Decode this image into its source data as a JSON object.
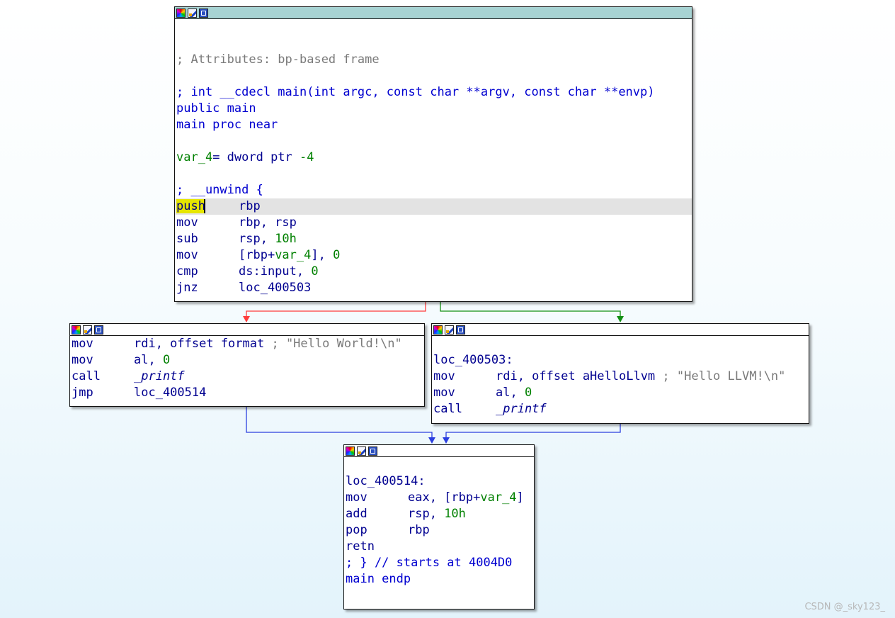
{
  "colors": {
    "edge_false": "#ff3b3b",
    "edge_true": "#138f13",
    "edge_unconditional": "#2b3fe0",
    "keyword_blue": "#0000d0",
    "number_green": "#008000",
    "comment_gray": "#7a7a7a",
    "active_titlebar": "#a7d3d3",
    "cursor_highlight": "#e6e600"
  },
  "titlebar_icons": [
    "color-palette-icon",
    "edit-node-icon",
    "graph-overview-icon"
  ],
  "node_main": {
    "lines": [
      {
        "text": ""
      },
      {
        "text": ""
      },
      {
        "comment": "; Attributes: bp-based frame"
      },
      {
        "text": ""
      },
      {
        "blue": "; int __cdecl main(int argc, const char **argv, const char **envp)"
      },
      {
        "blue": "public main"
      },
      {
        "blue": "main proc near"
      },
      {
        "text": ""
      },
      {
        "var_name": "var_4",
        "var_rest": "= dword ptr ",
        "var_num": "-4"
      },
      {
        "text": ""
      },
      {
        "blue": "; __unwind {"
      },
      {
        "mnemonic": "push",
        "operand": "rbp",
        "selected": true
      },
      {
        "mnemonic": "mov",
        "operand": "rbp, rsp"
      },
      {
        "mnemonic": "sub",
        "operand_pre": "rsp, ",
        "operand_num": "10h"
      },
      {
        "mnemonic": "mov",
        "operand_pre": "[rbp+",
        "operand_var": "var_4",
        "operand_post": "], ",
        "operand_num2": "0"
      },
      {
        "mnemonic": "cmp",
        "operand_pre": "ds:input, ",
        "operand_num": "0"
      },
      {
        "mnemonic": "jnz",
        "operand": "loc_400503"
      }
    ]
  },
  "node_hello_world": {
    "lines": [
      {
        "mnemonic": "mov",
        "operand": "rdi, offset format",
        "comment": " ; \"Hello World!\\n\""
      },
      {
        "mnemonic": "mov",
        "operand_pre": "al, ",
        "operand_num": "0"
      },
      {
        "mnemonic": "call",
        "operand": "_printf"
      },
      {
        "mnemonic": "jmp",
        "operand": "loc_400514"
      }
    ]
  },
  "node_hello_llvm": {
    "label": "loc_400503:",
    "lines": [
      {
        "mnemonic": "mov",
        "operand": "rdi, offset aHelloLlvm",
        "comment": " ; \"Hello LLVM!\\n\""
      },
      {
        "mnemonic": "mov",
        "operand_pre": "al, ",
        "operand_num": "0"
      },
      {
        "mnemonic": "call",
        "operand": "_printf"
      }
    ]
  },
  "node_exit": {
    "label": "loc_400514:",
    "lines": [
      {
        "mnemonic": "mov",
        "operand_pre": "eax, [rbp+",
        "operand_var": "var_4",
        "operand_post": "]"
      },
      {
        "mnemonic": "add",
        "operand_pre": "rsp, ",
        "operand_num": "10h"
      },
      {
        "mnemonic": "pop",
        "operand": "rbp"
      },
      {
        "mnemonic": "retn"
      },
      {
        "blue": "; } // starts at 4004D0"
      },
      {
        "blue": "main endp"
      }
    ]
  },
  "watermark": "CSDN @_sky123_"
}
